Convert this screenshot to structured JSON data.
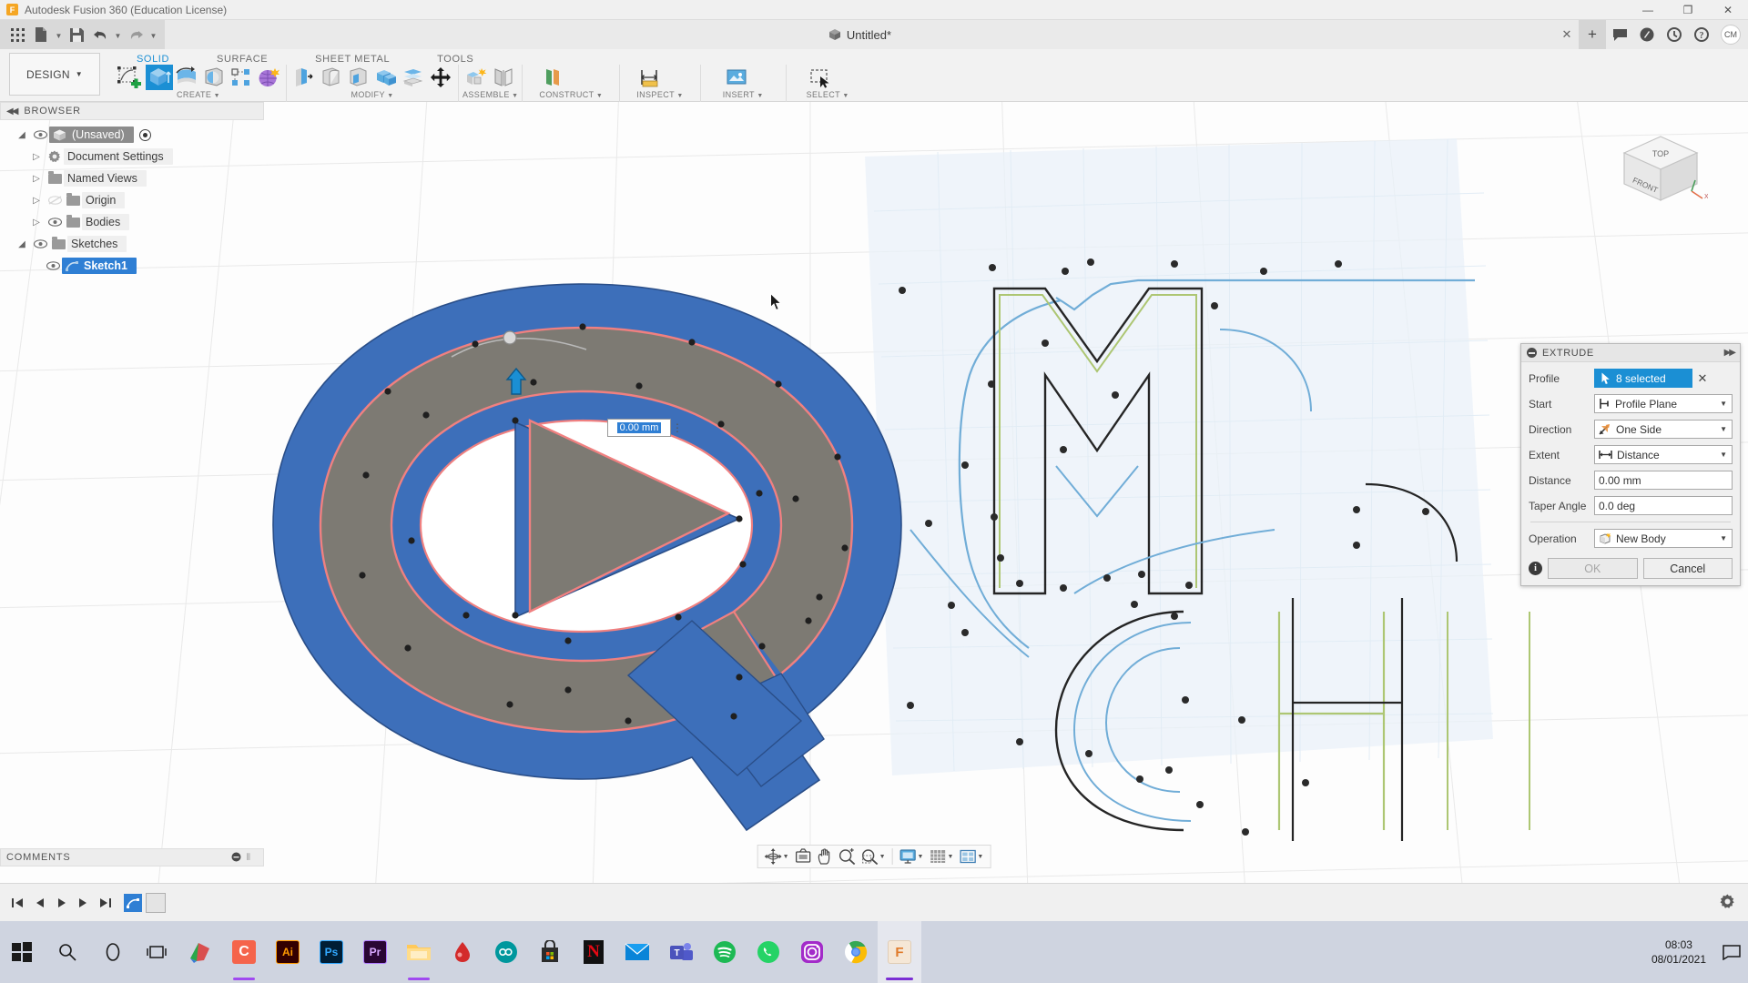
{
  "app": {
    "title": "Autodesk Fusion 360 (Education License)",
    "logo_text": "F",
    "window_controls": {
      "minimize": "—",
      "maximize": "❐",
      "close": "✕"
    }
  },
  "quick_access": {
    "grid_icon": "grid-icon",
    "new_icon": "new-document-icon",
    "save_icon": "save-icon",
    "undo_icon": "undo-icon",
    "redo_icon": "redo-icon",
    "document_title": "Untitled*",
    "tab_close": "✕",
    "new_tab": "+",
    "comment_icon": "comment-icon",
    "extensions_icon": "extensions-icon",
    "recent_icon": "recent-icon",
    "help_icon": "help-icon",
    "user_initials": "CM"
  },
  "ribbon": {
    "design_dropdown": "DESIGN",
    "workspace_tabs": [
      {
        "label": "SOLID",
        "active": true
      },
      {
        "label": "SURFACE",
        "active": false
      },
      {
        "label": "SHEET METAL",
        "active": false
      },
      {
        "label": "TOOLS",
        "active": false
      }
    ],
    "panels": [
      {
        "label": "CREATE",
        "has_caret": true,
        "tools": [
          "create-sketch-icon",
          "extrude-icon",
          "revolve-icon",
          "sweep-icon",
          "pattern-icon",
          "form-icon"
        ]
      },
      {
        "label": "MODIFY",
        "has_caret": true,
        "tools": [
          "press-pull-icon",
          "fillet-icon",
          "shell-icon",
          "combine-icon",
          "offset-face-icon",
          "move-copy-icon"
        ]
      },
      {
        "label": "ASSEMBLE",
        "has_caret": true,
        "tools": [
          "new-component-icon",
          "joint-icon"
        ]
      },
      {
        "label": "CONSTRUCT",
        "has_caret": true,
        "tools": [
          "offset-plane-icon"
        ]
      },
      {
        "label": "INSPECT",
        "has_caret": true,
        "tools": [
          "measure-icon"
        ]
      },
      {
        "label": "INSERT",
        "has_caret": true,
        "tools": [
          "insert-mcmaster-icon"
        ]
      },
      {
        "label": "SELECT",
        "has_caret": true,
        "tools": [
          "select-window-icon"
        ]
      }
    ]
  },
  "browser": {
    "header": "BROWSER",
    "collapse_icon": "collapse-left-icon",
    "items": [
      {
        "label": "(Unsaved)",
        "indent": 0,
        "expanded": true,
        "eye": true,
        "icon": "document-cube-icon",
        "state": "selected",
        "radio": true
      },
      {
        "label": "Document Settings",
        "indent": 1,
        "expanded": false,
        "eye": false,
        "icon": "gear-icon",
        "state": "normal"
      },
      {
        "label": "Named Views",
        "indent": 1,
        "expanded": false,
        "eye": false,
        "icon": "folder-icon",
        "state": "normal"
      },
      {
        "label": "Origin",
        "indent": 1,
        "expanded": false,
        "eye": "dim",
        "icon": "folder-icon",
        "state": "normal"
      },
      {
        "label": "Bodies",
        "indent": 1,
        "expanded": false,
        "eye": true,
        "icon": "folder-icon",
        "state": "normal"
      },
      {
        "label": "Sketches",
        "indent": 1,
        "expanded": true,
        "eye": true,
        "icon": "folder-icon",
        "state": "normal"
      },
      {
        "label": "Sketch1",
        "indent": 2,
        "expanded": false,
        "eye": true,
        "icon": "sketch-icon",
        "state": "sketch-selected"
      }
    ]
  },
  "comments": {
    "header": "COMMENTS"
  },
  "extrude_dialog": {
    "title": "EXTRUDE",
    "collapse_icon": "collapse-icon",
    "pin_icon": "pin-icon",
    "rows": [
      {
        "label": "Profile",
        "value": "8 selected",
        "type": "selection",
        "icon": "cursor-select-icon",
        "clear": "✕"
      },
      {
        "label": "Start",
        "value": "Profile Plane",
        "type": "dropdown",
        "icon": "profile-plane-icon"
      },
      {
        "label": "Direction",
        "value": "One Side",
        "type": "dropdown",
        "icon": "one-side-icon"
      },
      {
        "label": "Extent",
        "value": "Distance",
        "type": "dropdown",
        "icon": "distance-icon"
      },
      {
        "label": "Distance",
        "value": "0.00 mm",
        "type": "text"
      },
      {
        "label": "Taper Angle",
        "value": "0.0 deg",
        "type": "text"
      }
    ],
    "operation": {
      "label": "Operation",
      "value": "New Body",
      "icon": "new-body-icon"
    },
    "info_icon": "info-icon",
    "ok_label": "OK",
    "ok_enabled": false,
    "cancel_label": "Cancel"
  },
  "canvas": {
    "dimension_popup": {
      "value": "0.00 mm",
      "menu_icon": "kebab-menu-icon"
    },
    "manipulator_icon": "extrude-arrow-handle",
    "cursor_icon": "pointer-cursor",
    "viewcube": {
      "top_face": "TOP",
      "front_face": "FRONT",
      "axis_label": "X"
    },
    "colors": {
      "body_blue": "#3d6fba",
      "face_gray": "#7d7a73",
      "profile_pink": "#f08080",
      "sketch_blue": "#7fb5de",
      "sketch_green": "#a9c46c",
      "sketch_black": "#1a1a1a",
      "sketch_region": "#e7f1f8"
    }
  },
  "nav_toolbar": {
    "items": [
      {
        "icon": "orbit-icon",
        "caret": true
      },
      {
        "icon": "look-at-icon",
        "caret": false
      },
      {
        "icon": "pan-icon",
        "caret": false
      },
      {
        "icon": "zoom-icon",
        "caret": false
      },
      {
        "icon": "zoom-window-icon",
        "caret": true
      },
      {
        "icon": "display-settings-icon",
        "caret": true
      },
      {
        "icon": "grid-snaps-icon",
        "caret": true
      },
      {
        "icon": "viewports-icon",
        "caret": true
      }
    ]
  },
  "timeline": {
    "buttons": [
      "skip-start-icon",
      "step-back-icon",
      "play-icon",
      "step-forward-icon",
      "skip-end-icon"
    ],
    "feature_chip": "sketch1-feature-icon",
    "settings_icon": "timeline-settings-icon"
  },
  "taskbar": {
    "start": "start-icon",
    "search": "search-icon",
    "cortana": "cortana-icon",
    "taskview": "task-view-icon",
    "apps": [
      {
        "name": "paint-3d-icon",
        "label": "",
        "color": "#e8f0ff",
        "underline": ""
      },
      {
        "name": "cinema-4d-icon",
        "label": "C",
        "color": "#f5644b",
        "underline": "#a04af0"
      },
      {
        "name": "illustrator-icon",
        "label": "Ai",
        "color": "#330000",
        "underline": ""
      },
      {
        "name": "photoshop-icon",
        "label": "Ps",
        "color": "#001e36",
        "underline": ""
      },
      {
        "name": "premiere-icon",
        "label": "Pr",
        "color": "#2a0634",
        "underline": ""
      },
      {
        "name": "file-explorer-icon",
        "label": "",
        "color": "#ffc95b",
        "underline": "#a04af0"
      },
      {
        "name": "blood-drop-icon",
        "label": "",
        "color": "#ffffff",
        "underline": ""
      },
      {
        "name": "arduino-icon",
        "label": "∞",
        "color": "#00979d",
        "underline": ""
      },
      {
        "name": "microsoft-store-icon",
        "label": "",
        "color": "#2b2b2b",
        "underline": ""
      },
      {
        "name": "netflix-icon",
        "label": "N",
        "color": "#111111",
        "underline": ""
      },
      {
        "name": "mail-icon",
        "label": "",
        "color": "#0a84d8",
        "underline": ""
      },
      {
        "name": "teams-icon",
        "label": "T",
        "color": "#5059c9",
        "underline": ""
      },
      {
        "name": "spotify-icon",
        "label": "",
        "color": "#1db954",
        "underline": ""
      },
      {
        "name": "whatsapp-icon",
        "label": "",
        "color": "#25d366",
        "underline": ""
      },
      {
        "name": "instagram-icon",
        "label": "",
        "color": "#a32bc9",
        "underline": ""
      },
      {
        "name": "chrome-icon",
        "label": "",
        "color": "#ffffff",
        "underline": ""
      },
      {
        "name": "fusion360-icon",
        "label": "F",
        "color": "#f5e7d6",
        "underline": "#7b2fd4"
      }
    ],
    "clock_time": "08:03",
    "clock_date": "08/01/2021",
    "action_center": "action-center-icon"
  }
}
